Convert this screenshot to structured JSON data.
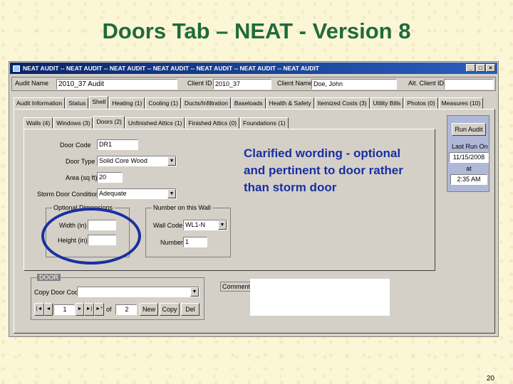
{
  "slide": {
    "title": "Doors Tab – NEAT - Version 8",
    "page_number": "20"
  },
  "window": {
    "title": "NEAT AUDIT  --  NEAT AUDIT  --  NEAT AUDIT  --  NEAT AUDIT  --  NEAT AUDIT  --  NEAT AUDIT  --  NEAT AUDIT",
    "minimize": "_",
    "maximize": "□",
    "close": "×"
  },
  "header": {
    "audit_name_label": "Audit Name",
    "audit_name_value": "2010_37 Audit",
    "client_id_label": "Client ID",
    "client_id_value": "2010_37",
    "client_name_label": "Client Name",
    "client_name_value": "Doe, John",
    "alt_client_id_label": "Alt. Client ID",
    "alt_client_id_value": ""
  },
  "main_tabs": [
    "Audit Information",
    "Status",
    "Shell",
    "Heating (1)",
    "Cooling (1)",
    "Ducts/Infiltration",
    "Baseloads",
    "Health & Safety",
    "Itemized Costs (3)",
    "Utility Bills",
    "Photos (0)",
    "Measures (10)"
  ],
  "sub_tabs": [
    "Walls (4)",
    "Windows (3)",
    "Doors (2)",
    "Unfinished Attics (1)",
    "Finished Attics (0)",
    "Foundations (1)"
  ],
  "door_form": {
    "door_code_label": "Door Code",
    "door_code_value": "DR1",
    "door_type_label": "Door Type",
    "door_type_value": "Solid Core Wood",
    "area_label": "Area (sq ft)",
    "area_value": "20",
    "storm_label": "Storm Door Condition",
    "storm_value": "Adequate"
  },
  "optional_dims": {
    "title": "Optional Dimensions",
    "width_label": "Width (in)",
    "width_value": "",
    "height_label": "Height (in)",
    "height_value": ""
  },
  "number_on_wall": {
    "title": "Number on this Wall",
    "wall_code_label": "Wall Code",
    "wall_code_value": "WL1-N",
    "number_label": "Number",
    "number_value": "1"
  },
  "door_group": {
    "title": "DOOR",
    "copy_label": "Copy Door Code",
    "copy_value": "",
    "nav_first": "|◄",
    "nav_prev": "◄",
    "current": "1",
    "nav_next": "►",
    "nav_last": "►|",
    "nav_new": "►*",
    "of_label": "of",
    "total": "2",
    "new_button": "New",
    "copy_button": "Copy",
    "del_button": "Del"
  },
  "comment_label": "Comment:",
  "comment_value": "",
  "run_panel": {
    "run_button": "Run Audit",
    "last_run_label": "Last Run On",
    "date_value": "11/15/2008",
    "at_label": "at",
    "time_value": "2:35 AM"
  },
  "annotation": "Clarified wording - optional and pertinent to door rather than storm door",
  "colors": {
    "title_green": "#1f6b3a",
    "annotation_blue": "#1a2fa0",
    "titlebar": "#0a246a"
  }
}
